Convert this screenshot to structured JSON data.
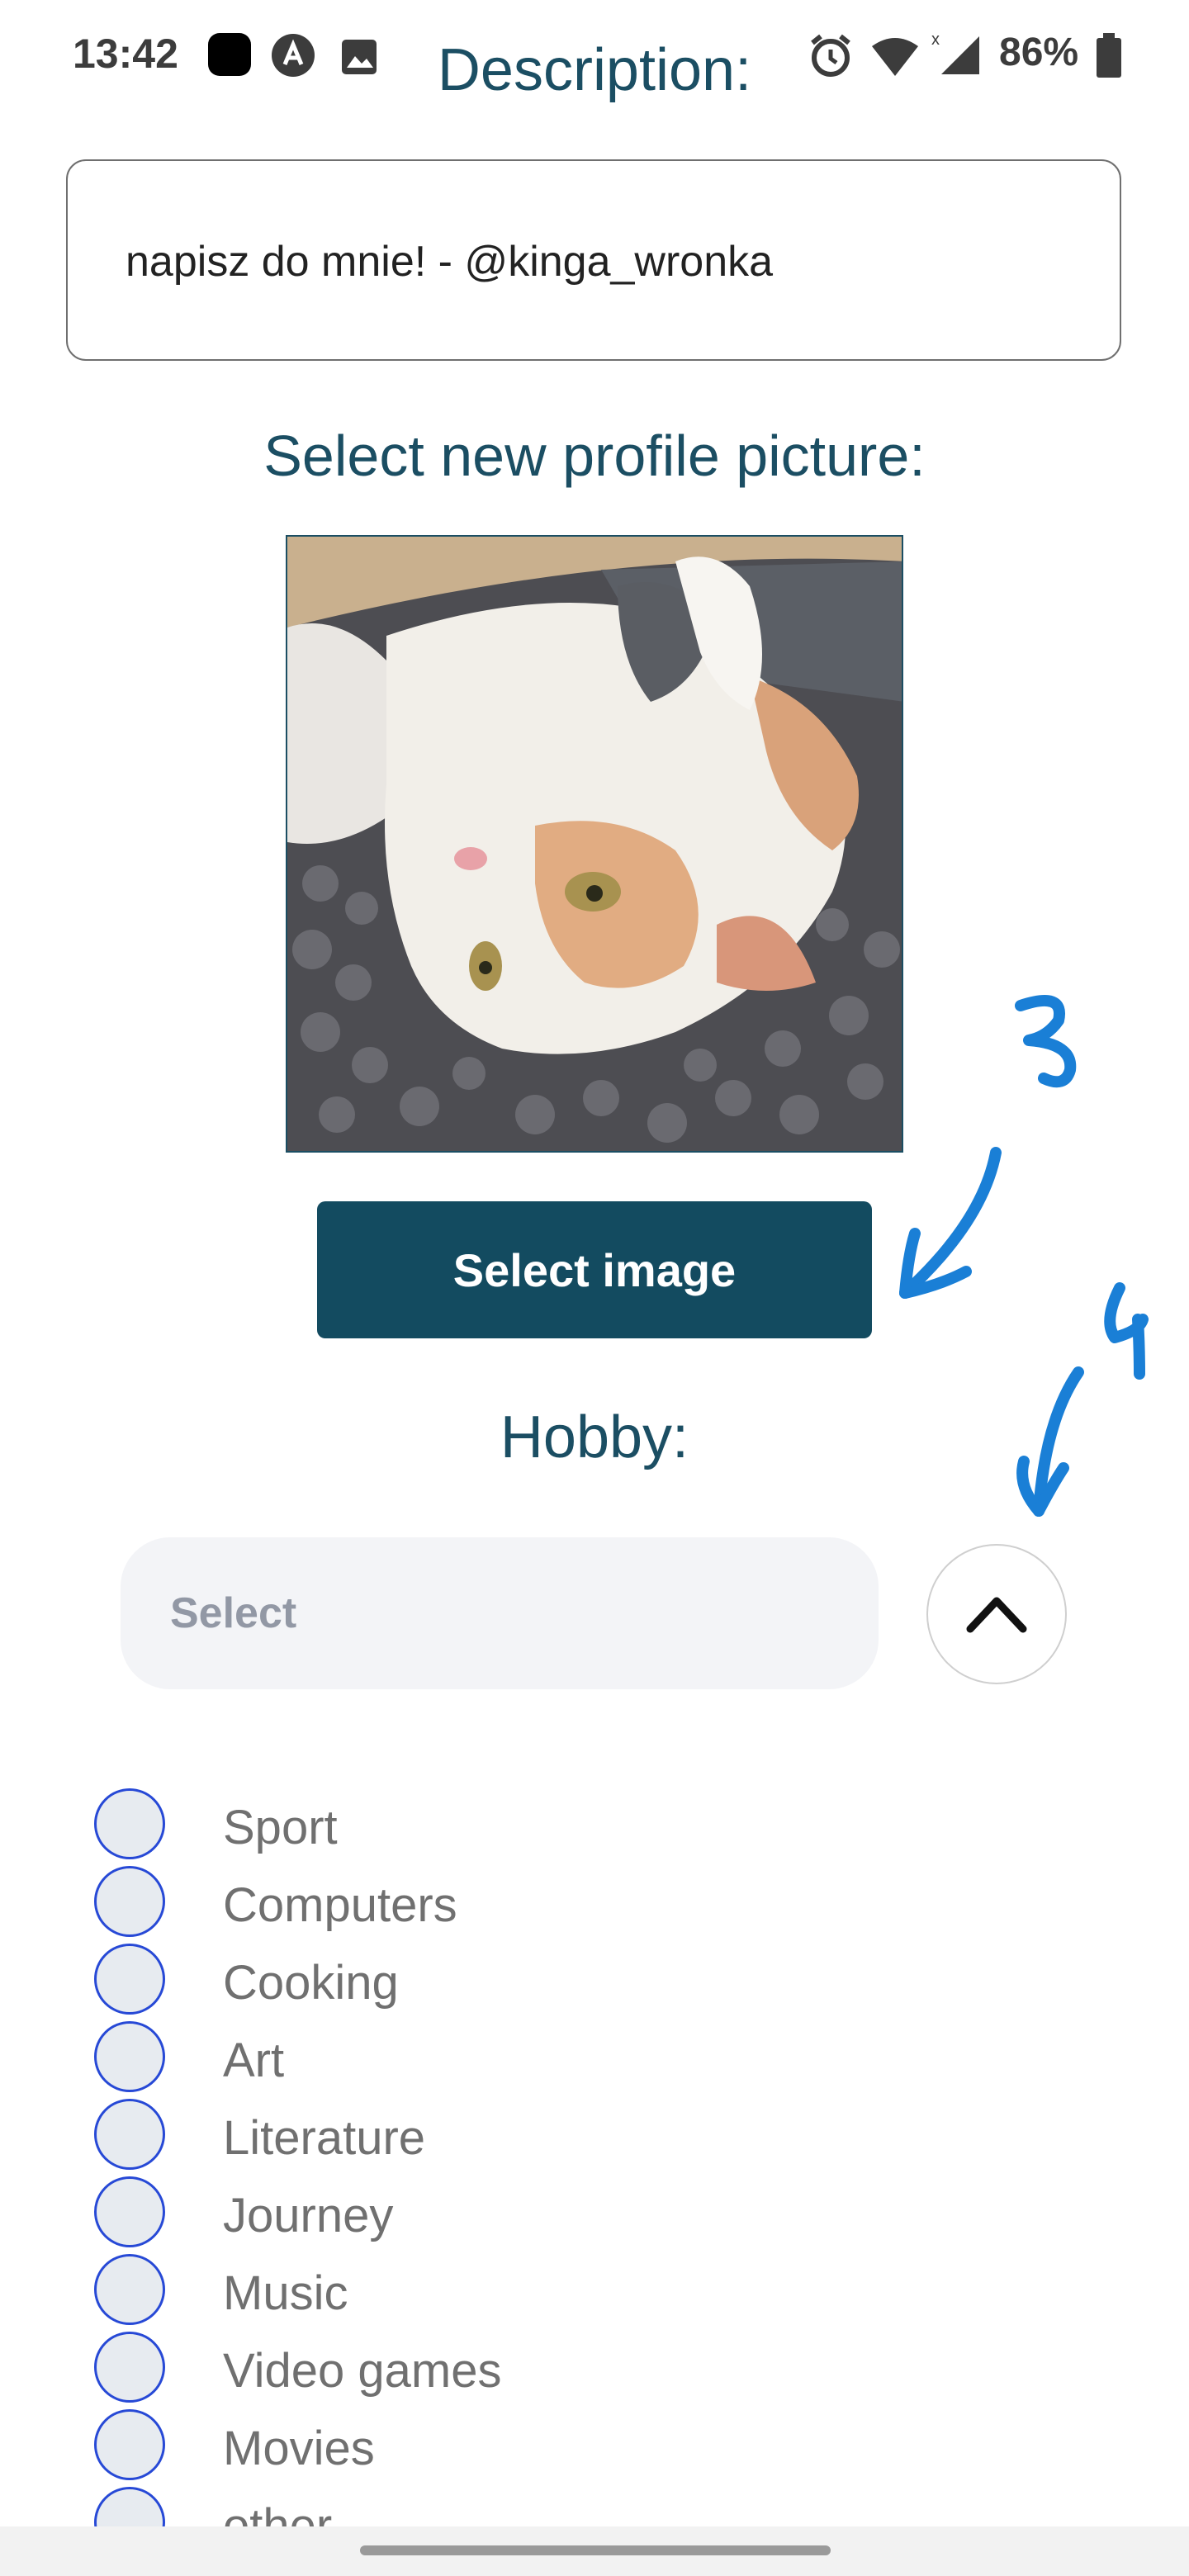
{
  "status_bar": {
    "time": "13:42",
    "battery": "86%",
    "icons": [
      "app-icon",
      "app-circle-icon",
      "image-icon",
      "alarm-icon",
      "wifi-icon",
      "signal-icon",
      "battery-icon"
    ]
  },
  "description": {
    "title": "Description:",
    "value": "napisz do mnie! - @kinga_wronka"
  },
  "profile_picture": {
    "title": "Select new profile picture:",
    "button_label": "Select image"
  },
  "hobby": {
    "title": "Hobby:",
    "select_placeholder": "Select",
    "toggle_icon": "chevron-up-icon",
    "options": [
      "Sport",
      "Computers",
      "Cooking",
      "Art",
      "Literature",
      "Journey",
      "Music",
      "Video games",
      "Movies",
      "other"
    ]
  },
  "annotations": {
    "number_3": "3",
    "number_4": "4",
    "color": "#1a7fd6"
  },
  "colors": {
    "primary": "#134b60",
    "title": "#1b4e63",
    "radio_border": "#2749d6"
  }
}
